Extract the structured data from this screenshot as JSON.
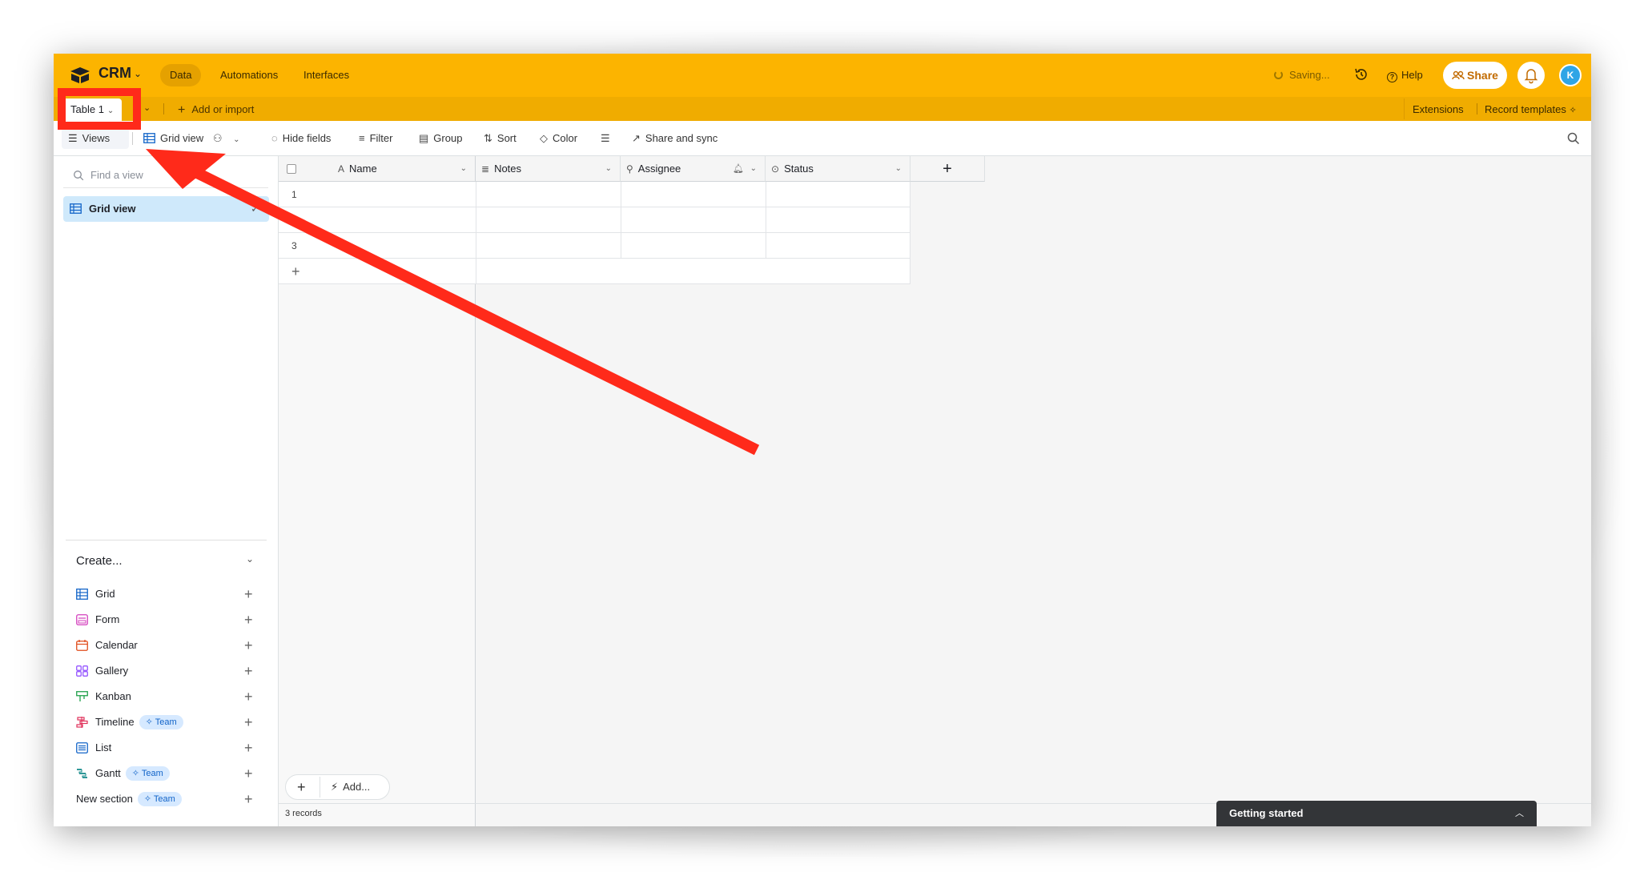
{
  "topbar": {
    "base_name": "CRM",
    "tabs": [
      "Data",
      "Automations",
      "Interfaces"
    ],
    "saving": "Saving...",
    "help": "Help",
    "share": "Share",
    "avatar_initial": "K",
    "accent": "#fcb400"
  },
  "tablebar": {
    "table_tab": "Table 1",
    "add_import": "Add or import",
    "extensions": "Extensions",
    "record_templates": "Record templates"
  },
  "viewbar": {
    "views": "Views",
    "view_name": "Grid view",
    "hide_fields": "Hide fields",
    "filter": "Filter",
    "group": "Group",
    "sort": "Sort",
    "color": "Color",
    "share_sync": "Share and sync"
  },
  "sidebar": {
    "find_placeholder": "Find a view",
    "active_view": "Grid view",
    "create_title": "Create...",
    "create_items": [
      {
        "label": "Grid",
        "icon": "grid-icon"
      },
      {
        "label": "Form",
        "icon": "form-icon"
      },
      {
        "label": "Calendar",
        "icon": "calendar-icon"
      },
      {
        "label": "Gallery",
        "icon": "gallery-icon"
      },
      {
        "label": "Kanban",
        "icon": "kanban-icon"
      },
      {
        "label": "Timeline",
        "icon": "timeline-icon",
        "badge": "Team"
      },
      {
        "label": "List",
        "icon": "list-icon"
      },
      {
        "label": "Gantt",
        "icon": "gantt-icon",
        "badge": "Team"
      },
      {
        "label": "New section",
        "icon": "",
        "badge": "Team"
      }
    ]
  },
  "grid": {
    "columns": [
      "Name",
      "Notes",
      "Assignee",
      "Status"
    ],
    "rows": [
      "1",
      "2",
      "3"
    ],
    "add_label": "Add...",
    "record_count": "3 records"
  },
  "getting_started": "Getting started"
}
